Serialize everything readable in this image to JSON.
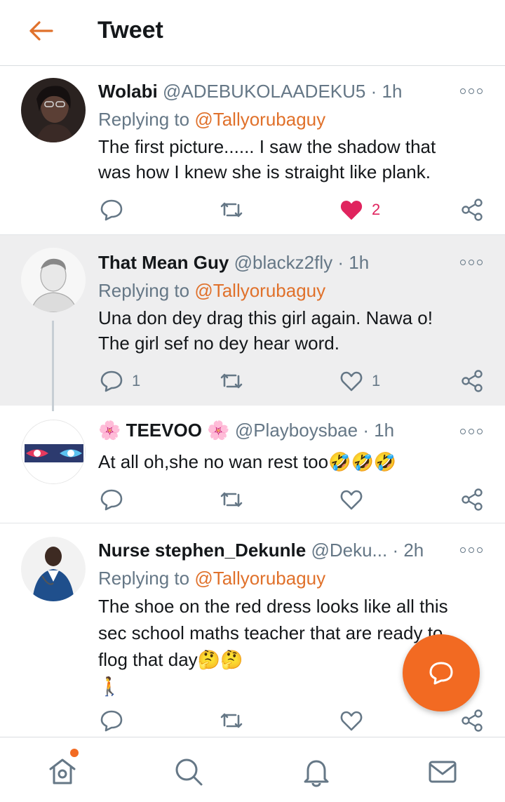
{
  "header": {
    "title": "Tweet"
  },
  "colors": {
    "accent": "#e0712b",
    "fab": "#f26a22",
    "like": "#e0245e",
    "muted": "#657786"
  },
  "tweets": [
    {
      "name": "Wolabi",
      "handle": "@ADEBUKOLAADEKU5",
      "time": "· 1h",
      "replying_prefix": "Replying to ",
      "replying_to": "@Tallyorubaguy",
      "text1": "The first picture...... I saw the shadow that",
      "text2": "was how I knew she is straight like plank.",
      "reply_count": "",
      "like_count": "2"
    },
    {
      "name": "That Mean Guy",
      "handle": "@blackz2fly",
      "time": "· 1h",
      "replying_prefix": "Replying to ",
      "replying_to": "@Tallyorubaguy",
      "text1": "Una don dey drag this girl again. Nawa o!",
      "text2": "The girl sef no dey hear word.",
      "reply_count": "1",
      "like_count": "1"
    },
    {
      "name": "TEEVOO",
      "name_emoji": "🌸",
      "handle": "@Playboysbae",
      "time": "· 1h",
      "text1": "At all oh,she no wan rest too",
      "text_emoji": "🤣🤣🤣"
    },
    {
      "name": "Nurse stephen_Dekunle",
      "handle": "@Deku...",
      "time": "· 2h",
      "replying_prefix": "Replying to ",
      "replying_to": "@Tallyorubaguy",
      "text1": "The shoe on the red dress looks like all this",
      "text2": "sec school maths teacher that are ready to",
      "text3": "flog that day",
      "text3_emoji": "🤔🤔",
      "text4_emoji": "🚶"
    }
  ],
  "icons": {
    "back": "arrow-left-icon",
    "reply": "speech-bubble-icon",
    "retweet": "retweet-icon",
    "like": "heart-icon",
    "share": "share-icon",
    "more": "more-dots-icon",
    "fab": "compose-reply-icon",
    "nav": [
      "home-icon",
      "search-icon",
      "bell-icon",
      "mail-icon"
    ]
  }
}
